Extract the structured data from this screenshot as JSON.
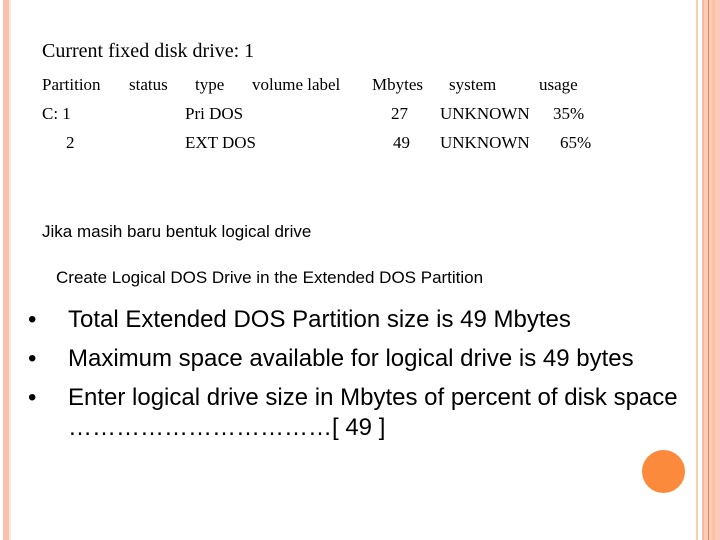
{
  "heading": "Current fixed disk drive: 1",
  "table": {
    "headers": [
      "Partition",
      "status",
      "type",
      "volume label",
      "Mbytes",
      "system",
      "usage"
    ],
    "rows": [
      {
        "partition": "C: 1",
        "status": "",
        "type": "Pri DOS",
        "volume_label": "",
        "mbytes": "27",
        "system": "UNKNOWN",
        "usage": "35%"
      },
      {
        "partition": "2",
        "status": "",
        "type": "EXT DOS",
        "volume_label": "",
        "mbytes": "49",
        "system": "UNKNOWN",
        "usage": "65%"
      }
    ]
  },
  "note": "Jika masih baru bentuk logical drive",
  "subtitle": "Create Logical DOS Drive in the Extended DOS Partition",
  "bullets": [
    {
      "text": "Total Extended DOS Partition size is 49 Mbytes"
    },
    {
      "text": "Maximum space available  for logical drive is 49 bytes"
    },
    {
      "text": "Enter logical drive size in Mbytes of percent of disk space   ……………………………[   49   ]"
    }
  ],
  "bullet_glyph": "•",
  "colors": {
    "accent_orange": "#fb8a3c",
    "border_peach": "#fccbb5"
  }
}
